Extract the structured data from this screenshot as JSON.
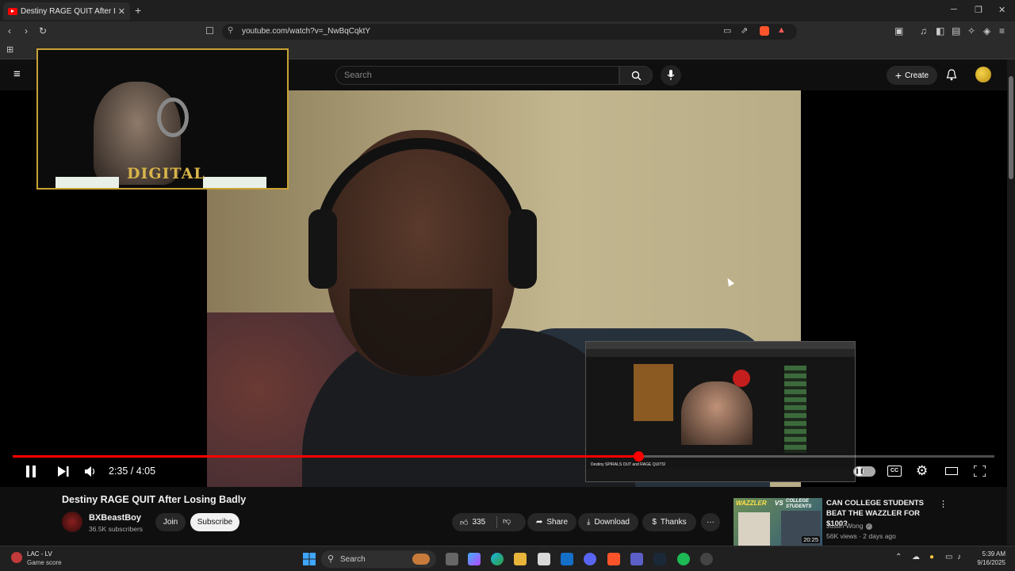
{
  "browser": {
    "tab_title": "Destiny RAGE QUIT After Losi",
    "tab_close": "✕",
    "new_tab": "+",
    "url": "youtube.com/watch?v=_NwBqCqktY",
    "win_min": "─",
    "win_max": "❐",
    "win_close": "✕"
  },
  "youtube": {
    "search_placeholder": "Search",
    "create_label": "Create"
  },
  "webcam": {
    "overlay_text": "DIGITAL"
  },
  "player": {
    "time": "2:35 / 4:05",
    "progress": 0.637,
    "overlay_caption": "Destiny SPIRALS OUT and RAGE QUITS!"
  },
  "video": {
    "title": "Destiny RAGE QUIT After Losing Badly",
    "channel": "BXBeastBoy",
    "subscribers": "36.5K subscribers",
    "join_label": "Join",
    "subscribe_label": "Subscribe",
    "likes": "335",
    "share_label": "Share",
    "download_label": "Download",
    "thanks_label": "Thanks",
    "more_label": "···"
  },
  "recommendation": {
    "title": "CAN COLLEGE STUDENTS BEAT THE WAZZLER FOR $100?",
    "channel": "Justin Wong",
    "meta": "56K views · 2 days ago",
    "duration": "20:25",
    "thumb_text_1": "WAZZLER",
    "thumb_text_2": "VS",
    "thumb_text_3": "COLLEGE STUDENTS"
  },
  "taskbar": {
    "weather_line1": "LAC - LV",
    "weather_line2": "Game score",
    "search_label": "Search",
    "time": "5:39 AM",
    "date": "9/16/2025"
  },
  "colors": {
    "accent": "#ff0000",
    "webcam_border": "#c9a234"
  }
}
